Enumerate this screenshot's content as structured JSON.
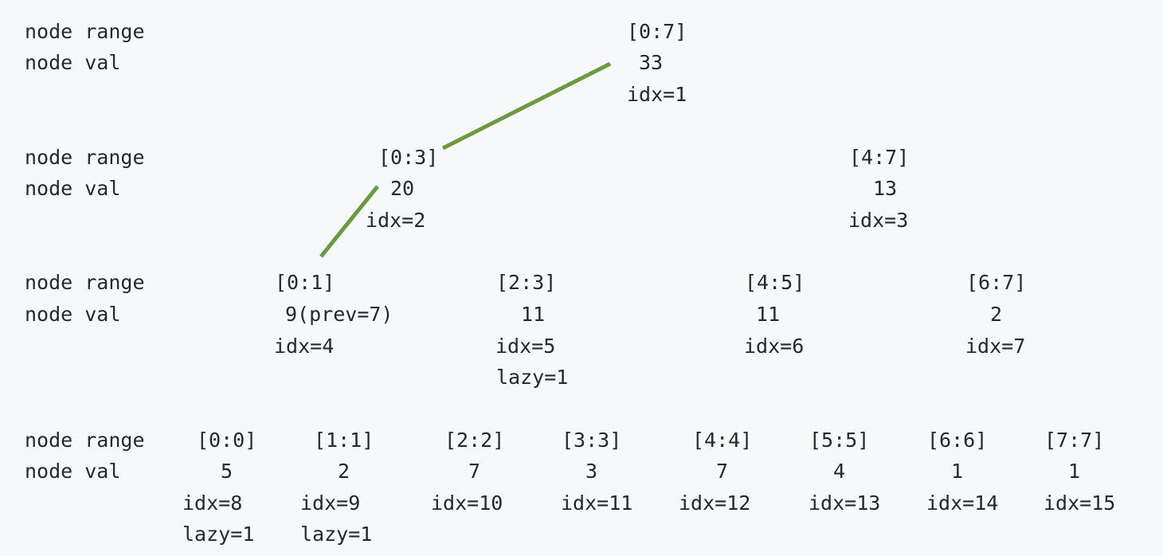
{
  "row_labels": {
    "range": "node range",
    "val": "node val"
  },
  "edge_color": "#6a9b41",
  "levels": [
    {
      "nodes": [
        {
          "range": "[0:7]",
          "val": "33",
          "idx": "idx=1"
        }
      ]
    },
    {
      "nodes": [
        {
          "range": "[0:3]",
          "val": "20",
          "idx": "idx=2"
        },
        {
          "range": "[4:7]",
          "val": "13",
          "idx": "idx=3"
        }
      ]
    },
    {
      "nodes": [
        {
          "range": "[0:1]",
          "val": "9(prev=7)",
          "idx": "idx=4"
        },
        {
          "range": "[2:3]",
          "val": "11",
          "idx": "idx=5",
          "lazy": "lazy=1"
        },
        {
          "range": "[4:5]",
          "val": "11",
          "idx": "idx=6"
        },
        {
          "range": "[6:7]",
          "val": "2",
          "idx": "idx=7"
        }
      ]
    },
    {
      "nodes": [
        {
          "range": "[0:0]",
          "val": "5",
          "idx": "idx=8",
          "lazy": "lazy=1"
        },
        {
          "range": "[1:1]",
          "val": "2",
          "idx": "idx=9",
          "lazy": "lazy=1"
        },
        {
          "range": "[2:2]",
          "val": "7",
          "idx": "idx=10"
        },
        {
          "range": "[3:3]",
          "val": "3",
          "idx": "idx=11"
        },
        {
          "range": "[4:4]",
          "val": "7",
          "idx": "idx=12"
        },
        {
          "range": "[5:5]",
          "val": "4",
          "idx": "idx=13"
        },
        {
          "range": "[6:6]",
          "val": "1",
          "idx": "idx=14"
        },
        {
          "range": "[7:7]",
          "val": "1",
          "idx": "idx=15"
        }
      ]
    }
  ]
}
